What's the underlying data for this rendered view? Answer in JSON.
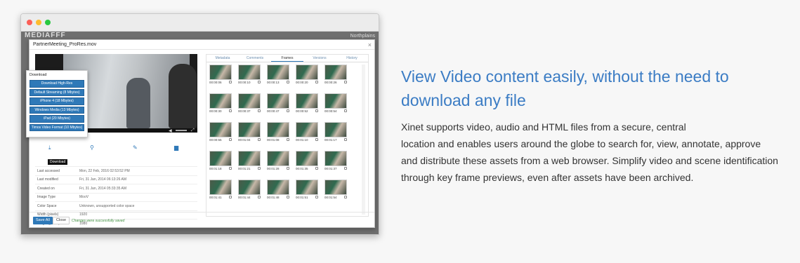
{
  "window": {
    "controls": {
      "close": "#fc5f57",
      "minimize": "#fdbc2e",
      "zoom": "#28c840"
    }
  },
  "app": {
    "logo": "MEDIAFFF",
    "brand_right": "Northplains"
  },
  "modal": {
    "title": "PartnerMeeting_ProRes.mov",
    "close": "×",
    "download": {
      "heading": "Download",
      "options": [
        "Download High-Res",
        "Default Streaming (8 Mbytes)",
        "iPhone 4 (18 Mbytes)",
        "Windows Media (13 Mbytes)",
        "iPad (20 Mbytes)",
        "Timos Video Format (10 Mbytes)"
      ]
    },
    "actions": {
      "download_tooltip": "Download",
      "icons": [
        "download-icon",
        "basket-icon",
        "wrench-icon",
        "folder-icon"
      ]
    },
    "metadata": [
      {
        "key": "Last accessed",
        "value": "Mon, 22 Feb, 2016 02:53:52 PM"
      },
      {
        "key": "Last modified",
        "value": "Fri, 31 Jan, 2014 06:13:26 AM"
      },
      {
        "key": "Created on",
        "value": "Fri, 31 Jan, 2014 05:33:35 AM"
      },
      {
        "key": "Image Type",
        "value": "MooV"
      },
      {
        "key": "Color Space",
        "value": "Unknown, unsupported color space"
      },
      {
        "key": "Width (pixels)",
        "value": "1920"
      },
      {
        "key": "Height (pixels)",
        "value": "1080"
      }
    ],
    "tabs": [
      "Metadata",
      "Comments",
      "Frames",
      "Versions",
      "History"
    ],
    "active_tab": "Frames",
    "frames": [
      [
        "00:00:06",
        "00:00:10",
        "00:00:13",
        "00:00:20",
        "00:00:26"
      ],
      [
        "00:00:30",
        "00:00:37",
        "00:00:47",
        "00:00:52",
        "00:00:54"
      ],
      [
        "00:00:55",
        "00:01:04",
        "00:01:08",
        "00:01:10",
        "00:01:17"
      ],
      [
        "00:01:18",
        "00:01:21",
        "00:01:28",
        "00:01:35",
        "00:01:37"
      ],
      [
        "00:01:41",
        "00:01:44",
        "00:01:48",
        "00:01:51",
        "00:01:54"
      ]
    ],
    "footer": {
      "save": "Save All",
      "close": "Close",
      "status": "Changes were successfully saved"
    }
  },
  "marketing": {
    "heading": "View Video content easily, without the need to download any file",
    "body": "Xinet supports video, audio and HTML files from a secure, central\nlocation and enables users around the globe to search for, view, annotate, approve\nand distribute these assets from a web browser. Simplify video and scene identification\nthrough key frame previews, even after assets have been archived."
  },
  "colors": {
    "accent": "#3b7cc4",
    "button": "#2f79b8",
    "background": "#f7f7f7"
  }
}
